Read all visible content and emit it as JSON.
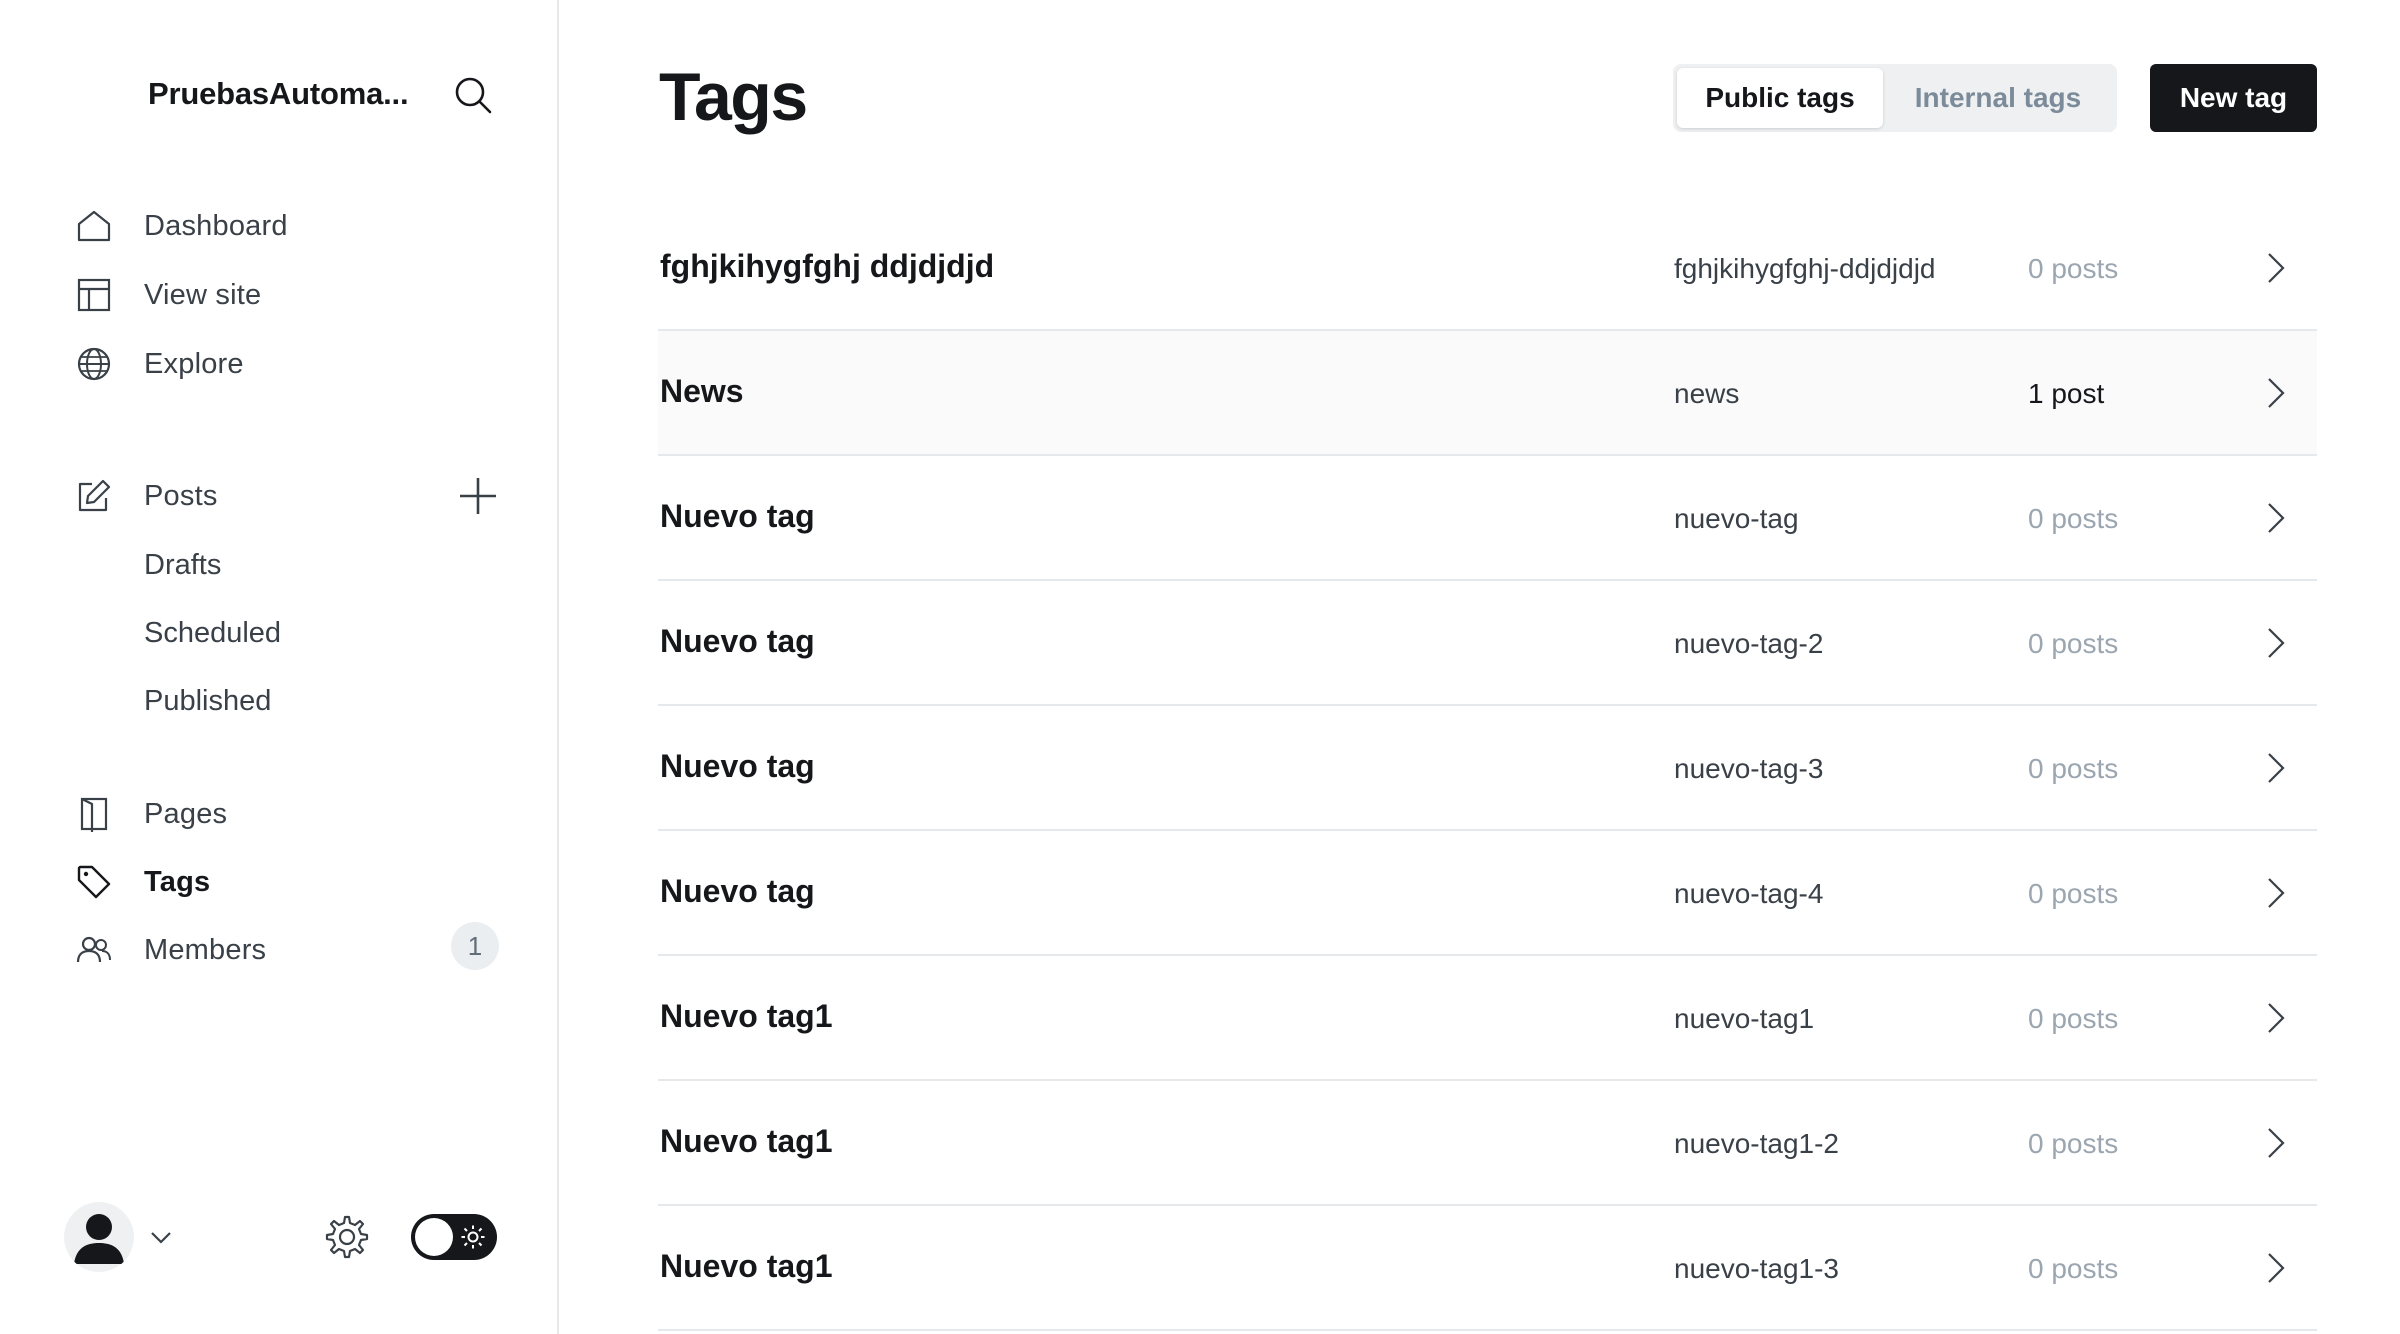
{
  "sidebar": {
    "site_title": "PruebasAutoma...",
    "nav": [
      {
        "label": "Dashboard",
        "icon": "home-icon"
      },
      {
        "label": "View site",
        "icon": "layout-icon"
      },
      {
        "label": "Explore",
        "icon": "globe-icon"
      }
    ],
    "posts": {
      "label": "Posts",
      "icon": "edit-icon",
      "sub_items": [
        "Drafts",
        "Scheduled",
        "Published"
      ]
    },
    "pages_label": "Pages",
    "tags_label": "Tags",
    "members_label": "Members",
    "members_badge": "1",
    "theme_toggle": "dark"
  },
  "header": {
    "title": "Tags",
    "tab_public": "Public tags",
    "tab_internal": "Internal tags",
    "new_tag_label": "New tag"
  },
  "tags": [
    {
      "name": "fghjkihygfghj ddjdjdjd",
      "slug": "fghjkihygfghj-ddjdjdjd",
      "count": "0 posts"
    },
    {
      "name": "News",
      "slug": "news",
      "count": "1 post"
    },
    {
      "name": "Nuevo tag",
      "slug": "nuevo-tag",
      "count": "0 posts"
    },
    {
      "name": "Nuevo tag",
      "slug": "nuevo-tag-2",
      "count": "0 posts"
    },
    {
      "name": "Nuevo tag",
      "slug": "nuevo-tag-3",
      "count": "0 posts"
    },
    {
      "name": "Nuevo tag",
      "slug": "nuevo-tag-4",
      "count": "0 posts"
    },
    {
      "name": "Nuevo tag1",
      "slug": "nuevo-tag1",
      "count": "0 posts"
    },
    {
      "name": "Nuevo tag1",
      "slug": "nuevo-tag1-2",
      "count": "0 posts"
    },
    {
      "name": "Nuevo tag1",
      "slug": "nuevo-tag1-3",
      "count": "0 posts"
    }
  ]
}
